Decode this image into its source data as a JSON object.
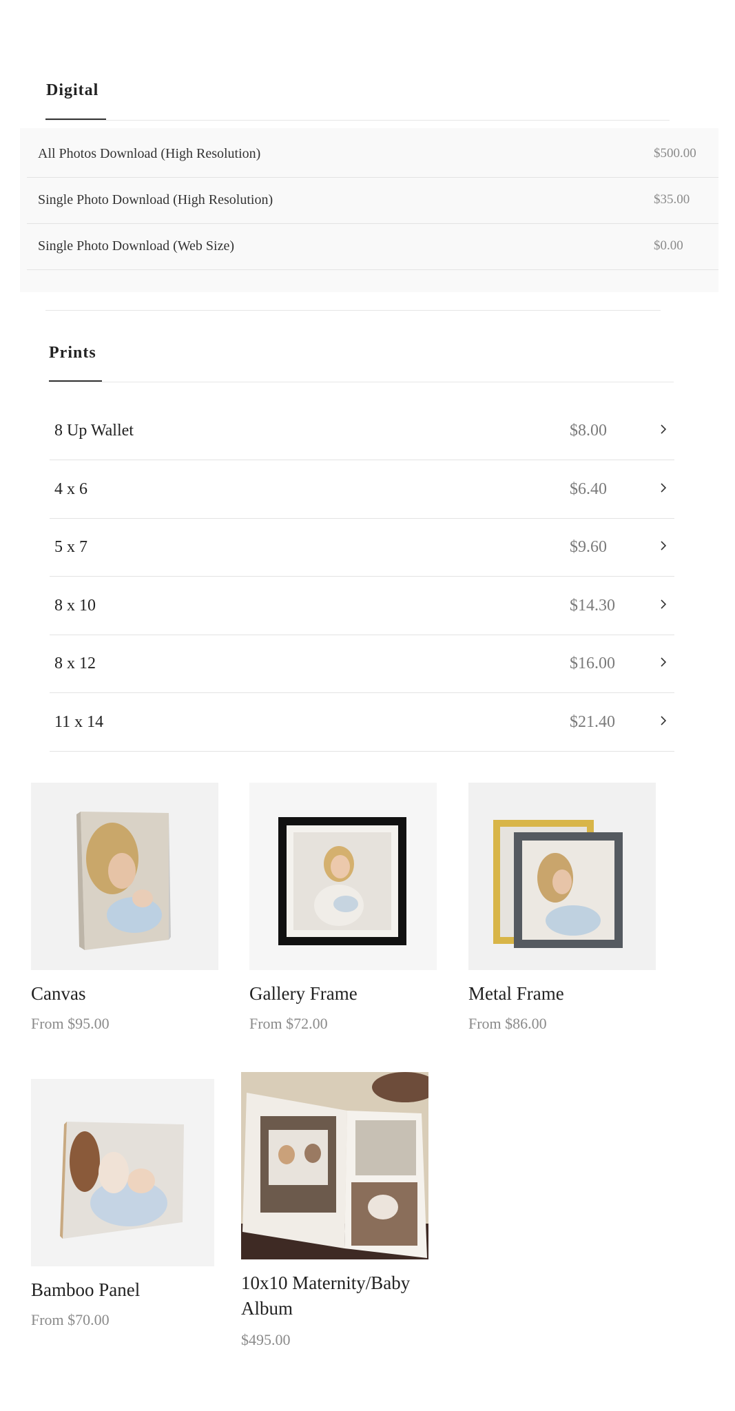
{
  "digital": {
    "title": "Digital",
    "items": [
      {
        "name": "All Photos Download (High Resolution)",
        "price": "$500.00"
      },
      {
        "name": "Single Photo Download (High Resolution)",
        "price": "$35.00"
      },
      {
        "name": "Single Photo Download (Web Size)",
        "price": "$0.00"
      }
    ]
  },
  "prints": {
    "title": "Prints",
    "items": [
      {
        "name": "8 Up Wallet",
        "price": "$8.00"
      },
      {
        "name": "4 x 6",
        "price": "$6.40"
      },
      {
        "name": "5 x 7",
        "price": "$9.60"
      },
      {
        "name": "8 x 10",
        "price": "$14.30"
      },
      {
        "name": "8 x 12",
        "price": "$16.00"
      },
      {
        "name": "11 x 14",
        "price": "$21.40"
      }
    ]
  },
  "products": [
    {
      "name": "Canvas",
      "price": "From $95.00",
      "icon": "canvas-photo"
    },
    {
      "name": "Gallery Frame",
      "price": "From $72.00",
      "icon": "gallery-frame-photo"
    },
    {
      "name": "Metal Frame",
      "price": "From $86.00",
      "icon": "metal-frame-photo"
    },
    {
      "name": "Bamboo Panel",
      "price": "From $70.00",
      "icon": "bamboo-panel-photo"
    },
    {
      "name": "10x10 Maternity/Baby Album",
      "price": "$495.00",
      "icon": "album-photo"
    }
  ],
  "colors": {
    "text": "#222222",
    "muted": "#8a8a8a",
    "rule": "#e3e3e3",
    "panel": "#f9f9f9"
  }
}
